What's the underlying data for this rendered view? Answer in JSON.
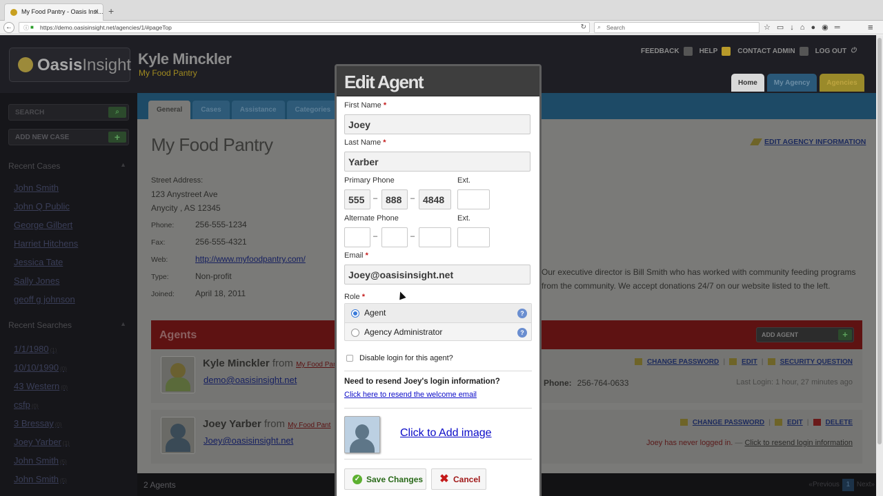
{
  "browser": {
    "tab_title": "My Food Pantry - Oasis Insi...",
    "new_tab_symbol": "+",
    "url": "https://demo.oasisinsight.net/agencies/1/#pageTop",
    "search_placeholder": "Search"
  },
  "header": {
    "logo_text_1": "Oasis",
    "logo_text_2": "Insight",
    "user_name": "Kyle Minckler",
    "user_agency": "My Food Pantry",
    "links": [
      "FEEDBACK",
      "HELP",
      "CONTACT ADMIN",
      "LOG OUT"
    ],
    "tabs": [
      "Home",
      "My Agency",
      "Agencies"
    ]
  },
  "sidebar": {
    "search_label": "SEARCH",
    "add_case_label": "ADD NEW CASE",
    "recent_cases_heading": "Recent Cases",
    "recent_cases": [
      "John Smith",
      "John Q Public",
      "George Gilbert",
      "Harriet Hitchens",
      "Jessica Tate",
      "Sally Jones",
      "geoff g johnson"
    ],
    "recent_searches_heading": "Recent Searches",
    "recent_searches": [
      {
        "label": "1/1/1980",
        "count": "(1)"
      },
      {
        "label": "10/10/1990",
        "count": "(0)"
      },
      {
        "label": "43 Western",
        "count": "(0)"
      },
      {
        "label": "csfp",
        "count": "(0)"
      },
      {
        "label": "3 Bressay",
        "count": "(0)"
      },
      {
        "label": "Joey Yarber",
        "count": "(1)"
      },
      {
        "label": "John Smith",
        "count": "(5)"
      },
      {
        "label": "John Smith",
        "count": "(5)"
      }
    ]
  },
  "agency": {
    "tabs": [
      "General",
      "Cases",
      "Assistance",
      "Categories"
    ],
    "title": "My Food Pantry",
    "edit_info_label": "EDIT AGENCY INFORMATION",
    "street_label": "Street Address:",
    "street_line1": "123 Anystreet Ave",
    "street_line2": "Anycity , AS 12345",
    "phone_label": "Phone:",
    "phone": "256-555-1234",
    "fax_label": "Fax:",
    "fax": "256-555-4321",
    "web_label": "Web:",
    "web": "http://www.myfoodpantry.com/",
    "type_label": "Type:",
    "type": "Non-profit",
    "joined_label": "Joined:",
    "joined": "April 18, 2011",
    "description_1": "Our executive director is Bill Smith who has worked with community feeding programs",
    "description_2": "from the community. We accept donations 24/7 on our website listed to the left."
  },
  "agents": {
    "heading": "Agents",
    "add_label": "ADD AGENT",
    "list": [
      {
        "name": "Kyle Minckler",
        "from": "from",
        "agency": "My Food Pant",
        "email": "demo@oasisinsight.net",
        "actions": [
          "CHANGE PASSWORD",
          "EDIT",
          "SECURITY QUESTION"
        ],
        "phone_label": "Phone:",
        "phone": "256-764-0633",
        "last_login": "Last Login: 1 hour, 27 minutes ago"
      },
      {
        "name": "Joey Yarber",
        "from": "from",
        "agency": "My Food Pant",
        "email": "Joey@oasisinsight.net",
        "actions": [
          "CHANGE PASSWORD",
          "EDIT",
          "DELETE"
        ],
        "never_logged": "Joey has never logged in.",
        "separator": "—",
        "resend_link": "Click to resend login information"
      }
    ],
    "count_label": "2 Agents",
    "pager_prev": "«Previous",
    "pager_page": "1",
    "pager_next": "Next»"
  },
  "modal": {
    "title": "Edit Agent",
    "required_mark": "*",
    "first_name_label": "First Name",
    "first_name": "Joey",
    "last_name_label": "Last Name",
    "last_name": "Yarber",
    "primary_phone_label": "Primary Phone",
    "primary_phone": [
      "555",
      "888",
      "4848"
    ],
    "ext_label": "Ext.",
    "primary_ext": "",
    "alternate_phone_label": "Alternate Phone",
    "alternate_phone": [
      "",
      "",
      ""
    ],
    "alternate_ext": "",
    "phone_dash": "–",
    "email_label": "Email",
    "email": "Joey@oasisinsight.net",
    "role_label": "Role",
    "roles": [
      {
        "label": "Agent",
        "selected": true
      },
      {
        "label": "Agency Administrator",
        "selected": false
      }
    ],
    "help_symbol": "?",
    "disable_login_label": "Disable login for this agent?",
    "resend_question": "Need to resend Joey's login information?",
    "resend_link": "Click here to resend the welcome email",
    "add_image_label": "Click to Add image",
    "save_label": "Save Changes",
    "cancel_label": "Cancel"
  },
  "colors": {
    "accent_blue": "#3a7ad8",
    "required_red": "#c41a1a",
    "link_blue": "#0a0ac8",
    "save_green": "#5cb030"
  }
}
